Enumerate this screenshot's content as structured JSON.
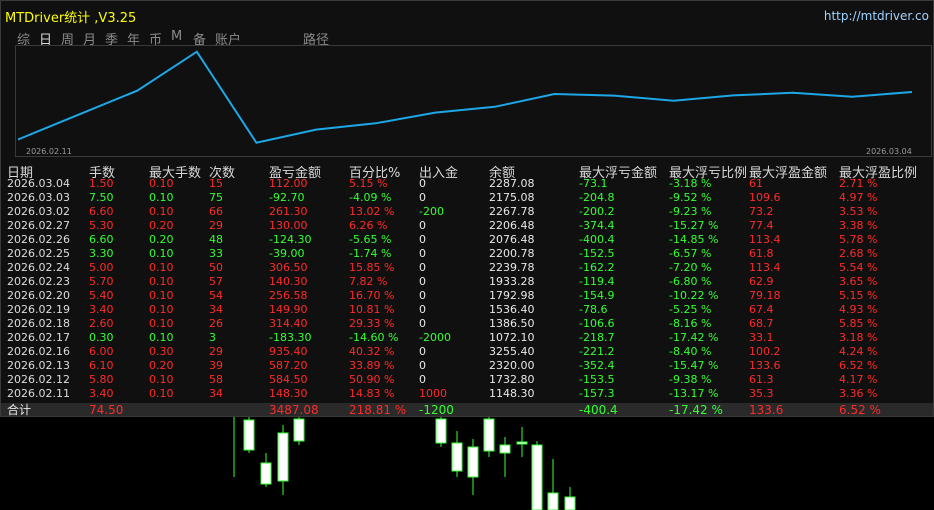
{
  "header": {
    "title": "MTDriver统计 ,V3.25",
    "url": "http://mtdriver.co"
  },
  "tabs": [
    {
      "label": "综",
      "active": false
    },
    {
      "label": "日",
      "active": true
    },
    {
      "label": "周",
      "active": false
    },
    {
      "label": "月",
      "active": false
    },
    {
      "label": "季",
      "active": false
    },
    {
      "label": "年",
      "active": false
    },
    {
      "label": "币",
      "active": false
    },
    {
      "label": "M",
      "active": false
    },
    {
      "label": "备",
      "active": false
    },
    {
      "label": "账户",
      "active": false
    },
    {
      "label": "路径",
      "active": false
    }
  ],
  "equity_chart": {
    "start_label": "2026.02.11",
    "end_label": "2026.03.04",
    "line_color": "#1ea7e6",
    "balances": [
      1148.3,
      1732.8,
      2320.0,
      3255.4,
      1072.1,
      1386.5,
      1536.4,
      1792.98,
      1933.28,
      2239.78,
      2200.78,
      2076.48,
      2206.48,
      2267.78,
      2175.08,
      2287.08
    ]
  },
  "columns": [
    "日期",
    "手数",
    "最大手数",
    "次数",
    "盈亏金额",
    "百分比%",
    "出入金",
    "余额",
    "最大浮亏金额",
    "最大浮亏比例",
    "最大浮盈金额",
    "最大浮盈比例"
  ],
  "rows": [
    {
      "date": "2026.03.04",
      "lots": "1.50",
      "max_lots": "0.10",
      "count": "15",
      "pnl": "112.00",
      "pct": "5.15 %",
      "flow": "0",
      "balance": "2287.08",
      "max_loss": "-73.1",
      "max_loss_pct": "-3.18 %",
      "max_gain": "61",
      "max_gain_pct": "2.71 %"
    },
    {
      "date": "2026.03.03",
      "lots": "7.50",
      "max_lots": "0.10",
      "count": "75",
      "pnl": "-92.70",
      "pct": "-4.09 %",
      "flow": "0",
      "balance": "2175.08",
      "max_loss": "-204.8",
      "max_loss_pct": "-9.52 %",
      "max_gain": "109.6",
      "max_gain_pct": "4.97 %"
    },
    {
      "date": "2026.03.02",
      "lots": "6.60",
      "max_lots": "0.10",
      "count": "66",
      "pnl": "261.30",
      "pct": "13.02 %",
      "flow": "-200",
      "balance": "2267.78",
      "max_loss": "-200.2",
      "max_loss_pct": "-9.23 %",
      "max_gain": "73.2",
      "max_gain_pct": "3.53 %"
    },
    {
      "date": "2026.02.27",
      "lots": "5.30",
      "max_lots": "0.20",
      "count": "29",
      "pnl": "130.00",
      "pct": "6.26 %",
      "flow": "0",
      "balance": "2206.48",
      "max_loss": "-374.4",
      "max_loss_pct": "-15.27 %",
      "max_gain": "77.4",
      "max_gain_pct": "3.38 %"
    },
    {
      "date": "2026.02.26",
      "lots": "6.60",
      "max_lots": "0.20",
      "count": "48",
      "pnl": "-124.30",
      "pct": "-5.65 %",
      "flow": "0",
      "balance": "2076.48",
      "max_loss": "-400.4",
      "max_loss_pct": "-14.85 %",
      "max_gain": "113.4",
      "max_gain_pct": "5.78 %"
    },
    {
      "date": "2026.02.25",
      "lots": "3.30",
      "max_lots": "0.10",
      "count": "33",
      "pnl": "-39.00",
      "pct": "-1.74 %",
      "flow": "0",
      "balance": "2200.78",
      "max_loss": "-152.5",
      "max_loss_pct": "-6.57 %",
      "max_gain": "61.8",
      "max_gain_pct": "2.68 %"
    },
    {
      "date": "2026.02.24",
      "lots": "5.00",
      "max_lots": "0.10",
      "count": "50",
      "pnl": "306.50",
      "pct": "15.85 %",
      "flow": "0",
      "balance": "2239.78",
      "max_loss": "-162.2",
      "max_loss_pct": "-7.20 %",
      "max_gain": "113.4",
      "max_gain_pct": "5.54 %"
    },
    {
      "date": "2026.02.23",
      "lots": "5.70",
      "max_lots": "0.10",
      "count": "57",
      "pnl": "140.30",
      "pct": "7.82 %",
      "flow": "0",
      "balance": "1933.28",
      "max_loss": "-119.4",
      "max_loss_pct": "-6.80 %",
      "max_gain": "62.9",
      "max_gain_pct": "3.65 %"
    },
    {
      "date": "2026.02.20",
      "lots": "5.40",
      "max_lots": "0.10",
      "count": "54",
      "pnl": "256.58",
      "pct": "16.70 %",
      "flow": "0",
      "balance": "1792.98",
      "max_loss": "-154.9",
      "max_loss_pct": "-10.22 %",
      "max_gain": "79.18",
      "max_gain_pct": "5.15 %"
    },
    {
      "date": "2026.02.19",
      "lots": "3.40",
      "max_lots": "0.10",
      "count": "34",
      "pnl": "149.90",
      "pct": "10.81 %",
      "flow": "0",
      "balance": "1536.40",
      "max_loss": "-78.6",
      "max_loss_pct": "-5.25 %",
      "max_gain": "67.4",
      "max_gain_pct": "4.93 %"
    },
    {
      "date": "2026.02.18",
      "lots": "2.60",
      "max_lots": "0.10",
      "count": "26",
      "pnl": "314.40",
      "pct": "29.33 %",
      "flow": "0",
      "balance": "1386.50",
      "max_loss": "-106.6",
      "max_loss_pct": "-8.16 %",
      "max_gain": "68.7",
      "max_gain_pct": "5.85 %"
    },
    {
      "date": "2026.02.17",
      "lots": "0.30",
      "max_lots": "0.10",
      "count": "3",
      "pnl": "-183.30",
      "pct": "-14.60 %",
      "flow": "-2000",
      "balance": "1072.10",
      "max_loss": "-218.7",
      "max_loss_pct": "-17.42 %",
      "max_gain": "33.1",
      "max_gain_pct": "3.18 %"
    },
    {
      "date": "2026.02.16",
      "lots": "6.00",
      "max_lots": "0.30",
      "count": "29",
      "pnl": "935.40",
      "pct": "40.32 %",
      "flow": "0",
      "balance": "3255.40",
      "max_loss": "-221.2",
      "max_loss_pct": "-8.40 %",
      "max_gain": "100.2",
      "max_gain_pct": "4.24 %"
    },
    {
      "date": "2026.02.13",
      "lots": "6.10",
      "max_lots": "0.20",
      "count": "39",
      "pnl": "587.20",
      "pct": "33.89 %",
      "flow": "0",
      "balance": "2320.00",
      "max_loss": "-352.4",
      "max_loss_pct": "-15.47 %",
      "max_gain": "133.6",
      "max_gain_pct": "6.52 %"
    },
    {
      "date": "2026.02.12",
      "lots": "5.80",
      "max_lots": "0.10",
      "count": "58",
      "pnl": "584.50",
      "pct": "50.90 %",
      "flow": "0",
      "balance": "1732.80",
      "max_loss": "-153.5",
      "max_loss_pct": "-9.38 %",
      "max_gain": "61.3",
      "max_gain_pct": "4.17 %"
    },
    {
      "date": "2026.02.11",
      "lots": "3.40",
      "max_lots": "0.10",
      "count": "34",
      "pnl": "148.30",
      "pct": "14.83 %",
      "flow": "1000",
      "balance": "1148.30",
      "max_loss": "-157.3",
      "max_loss_pct": "-13.17 %",
      "max_gain": "35.3",
      "max_gain_pct": "3.36 %"
    }
  ],
  "total": {
    "label": "合计",
    "lots": "74.50",
    "pnl": "3487.08",
    "pct": "218.81 %",
    "flow": "-1200",
    "max_loss": "-400.4",
    "max_loss_pct": "-17.42 %",
    "max_gain": "133.6",
    "max_gain_pct": "6.52 %"
  },
  "colors": {
    "positive": "#ff2a2a",
    "negative": "#33ff33",
    "neutral": "#e8e8e8",
    "candle_wick": "#33ff33",
    "candle_body": "#ffffff"
  }
}
